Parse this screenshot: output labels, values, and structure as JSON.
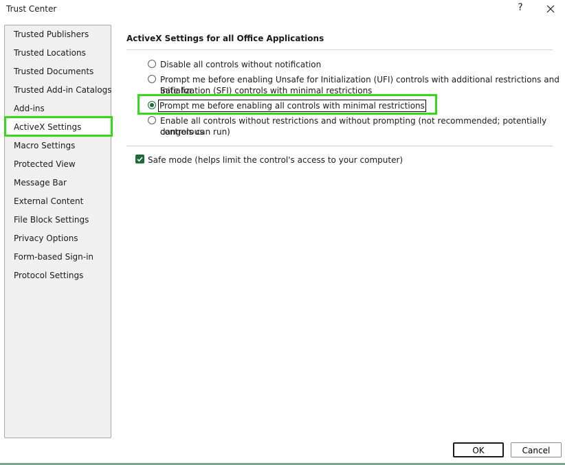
{
  "window": {
    "title": "Trust Center",
    "help_label": "?"
  },
  "sidebar": {
    "items": [
      {
        "label": "Trusted Publishers"
      },
      {
        "label": "Trusted Locations"
      },
      {
        "label": "Trusted Documents"
      },
      {
        "label": "Trusted Add-in Catalogs"
      },
      {
        "label": "Add-ins"
      },
      {
        "label": "ActiveX Settings"
      },
      {
        "label": "Macro Settings"
      },
      {
        "label": "Protected View"
      },
      {
        "label": "Message Bar"
      },
      {
        "label": "External Content"
      },
      {
        "label": "File Block Settings"
      },
      {
        "label": "Privacy Options"
      },
      {
        "label": "Form-based Sign-in"
      },
      {
        "label": "Protocol Settings"
      }
    ],
    "selected": "ActiveX Settings"
  },
  "main": {
    "section_title": "ActiveX Settings for all Office Applications",
    "options": [
      {
        "line1": "Disable all controls without notification",
        "line2": "",
        "checked": false
      },
      {
        "line1": "Prompt me before enabling Unsafe for Initialization (UFI) controls with additional restrictions and Safe for",
        "line2": "Initialization (SFI) controls with minimal restrictions",
        "checked": false
      },
      {
        "line1": "Prompt me before enabling all controls with minimal restrictions",
        "line2": "",
        "checked": true
      },
      {
        "line1": "Enable all controls without restrictions and without prompting (not recommended; potentially dangerous",
        "line2": "controls can run)",
        "checked": false
      }
    ],
    "safe_mode": {
      "label": "Safe mode (helps limit the control's access to your computer)",
      "checked": true
    }
  },
  "buttons": {
    "ok": "OK",
    "cancel": "Cancel"
  },
  "colors": {
    "accent": "#1e6b3a",
    "highlight": "#3ad61d"
  }
}
